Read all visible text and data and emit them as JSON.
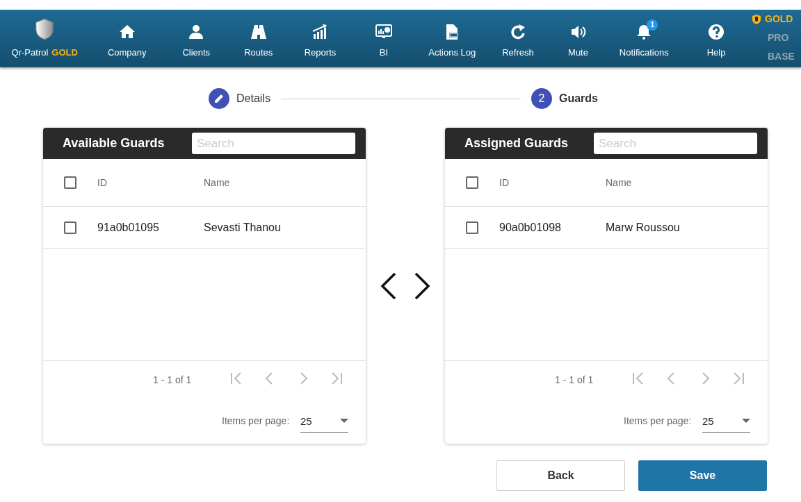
{
  "navbar": {
    "brand": {
      "name": "Qr-Patrol",
      "tier": "GOLD"
    },
    "items": [
      {
        "label": "Company"
      },
      {
        "label": "Clients"
      },
      {
        "label": "Routes"
      },
      {
        "label": "Reports"
      },
      {
        "label": "BI"
      },
      {
        "label": "Actions Log"
      },
      {
        "label": "Refresh"
      },
      {
        "label": "Mute"
      },
      {
        "label": "Notifications",
        "badge": "1"
      },
      {
        "label": "Help"
      }
    ],
    "plans": [
      {
        "label": "GOLD",
        "selected": true
      },
      {
        "label": "PRO",
        "selected": false
      },
      {
        "label": "BASE",
        "selected": false
      }
    ]
  },
  "stepper": [
    {
      "label": "Details",
      "selected": false
    },
    {
      "label": "Guards",
      "number": "2",
      "selected": true
    }
  ],
  "panels": [
    {
      "title": "Available Guards",
      "search": {
        "placeholder": "Search"
      },
      "columns": [
        "ID",
        "Name"
      ],
      "header_checked": false,
      "rows": [
        {
          "id": "91a0b01095",
          "name": "Sevasti Thanou",
          "checked": false
        }
      ],
      "range": "1 - 1 of 1",
      "items_per_page_label": "Items per page:",
      "items_per_page": "25"
    },
    {
      "title": "Assigned Guards",
      "search": {
        "placeholder": "Search"
      },
      "columns": [
        "ID",
        "Name"
      ],
      "header_checked": false,
      "rows": [
        {
          "id": "90a0b01098",
          "name": "Marw Roussou",
          "checked": false
        }
      ],
      "range": "1 - 1 of 1",
      "items_per_page_label": "Items per page:",
      "items_per_page": "25"
    }
  ],
  "buttons": [
    {
      "label": "Back",
      "kind": "secondary"
    },
    {
      "label": "Save",
      "kind": "primary"
    }
  ]
}
